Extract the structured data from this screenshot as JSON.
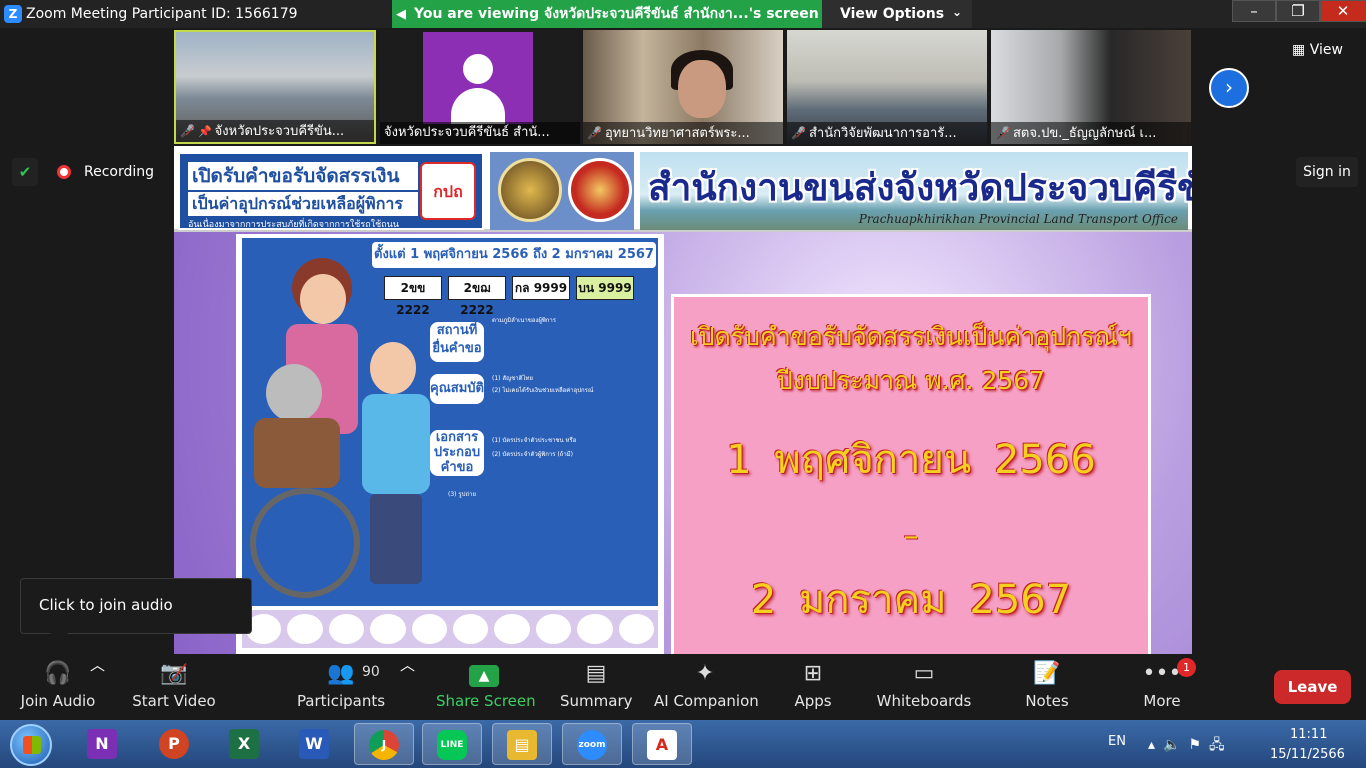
{
  "window": {
    "app_icon": "Z",
    "title": "Zoom Meeting Participant ID: 1566179",
    "banner": "You  are viewing จังหวัดประจวบคีรีขันธ์ สำนักงา...'s screen",
    "view_options": "View Options",
    "minimize": "–",
    "restore": "❐",
    "close": "✕"
  },
  "gallery": {
    "view_label": "View",
    "participants": [
      {
        "name": "จังหวัดประจวบคีรีขัน...",
        "muted": true,
        "pinned": true
      },
      {
        "name": "จังหวัดประจวบคีรีขันธ์ สำนั...",
        "muted": false,
        "pinned": false
      },
      {
        "name": "อุทยานวิทยาศาสตร์พระ...",
        "muted": true,
        "pinned": false
      },
      {
        "name": "สำนักวิจัยพัฒนาการอารั...",
        "muted": true,
        "pinned": false
      },
      {
        "name": "สตจ.ปข._ธัญญลักษณ์ เ...",
        "muted": true,
        "pinned": false
      }
    ],
    "next_icon": "›"
  },
  "status": {
    "recording_label": "Recording",
    "sign_in_label": "Sign in",
    "shield_icon": "✔"
  },
  "shared_screen": {
    "header_left_line1": "เปิดรับคำขอรับจัดสรรเงิน",
    "header_left_line2": "เป็นค่าอุปกรณ์ช่วยเหลือผู้พิการ",
    "header_left_line3": "อันเนื่องมาจากการประสบภัยที่เกิดจากการใช้รถใช้ถนน",
    "header_left_logo": "กปถ",
    "header_right_thai": "สำนักงานขนส่งจังหวัดประจวบคีรีขันธ์",
    "header_right_en": "Prachuapkhirikhan Provincial Land Transport Office",
    "poster_date": "ตั้งแต่ 1 พฤศจิกายน 2566 ถึง 2 มกราคม 2567",
    "plates": [
      "2ขข 2222",
      "2ขฌ 2222",
      "กล 9999",
      "บน 9999"
    ],
    "poster_labels": [
      "สถานที่ยื่นคำขอ",
      "คุณสมบัติ",
      "เอกสารประกอบคำขอ"
    ],
    "poster_notes": [
      "ตามภูมิลำเนาของผู้พิการ",
      "(1) สัญชาติไทย",
      "(2) ไม่เคยได้รับเงินช่วยเหลือค่าอุปกรณ์",
      "(1) บัตรประจำตัวประชาชน หรือ",
      "(2) บัตรประจำตัวผู้พิการ (ถ้ามี)",
      "(3) รูปถ่าย"
    ],
    "panel_line1": "เปิดรับคำขอรับจัดสรรเงินเป็นค่าอุปกรณ์ฯ",
    "panel_line2": "ปีงบประมาณ พ.ศ. 2567",
    "panel_date_start": "1  พฤศจิกายน  2566",
    "panel_dash": "–",
    "panel_date_end": "2  มกราคม  2567"
  },
  "tooltip": {
    "text": "Click to join audio"
  },
  "toolbar": {
    "join_audio": "Join Audio",
    "start_video": "Start Video",
    "participants": "Participants",
    "participant_count": "90",
    "share_screen": "Share Screen",
    "summary": "Summary",
    "ai_companion": "AI Companion",
    "apps": "Apps",
    "whiteboards": "Whiteboards",
    "notes": "Notes",
    "more": "More",
    "more_badge": "1",
    "leave": "Leave"
  },
  "taskbar": {
    "apps": [
      {
        "name": "OneNote",
        "glyph": "N",
        "color": "#7b2fb5"
      },
      {
        "name": "PowerPoint",
        "glyph": "P",
        "color": "#d04423"
      },
      {
        "name": "Excel",
        "glyph": "X",
        "color": "#1d7044"
      },
      {
        "name": "Word",
        "glyph": "W",
        "color": "#2a5ab8"
      },
      {
        "name": "Chrome",
        "glyph": "J",
        "color": "#2f9e44"
      },
      {
        "name": "LINE",
        "glyph": "LINE",
        "color": "#06c755"
      },
      {
        "name": "File Explorer",
        "glyph": "▤",
        "color": "#e8b830"
      },
      {
        "name": "Zoom",
        "glyph": "zoom",
        "color": "#2d8cff"
      },
      {
        "name": "Acrobat",
        "glyph": "A",
        "color": "#d42a20"
      }
    ],
    "language": "EN",
    "time": "11:11",
    "date": "15/11/2566"
  },
  "colors": {
    "zoom_green": "#23a247",
    "leave_red": "#cc2a2a",
    "zoom_blue": "#2d8cff"
  }
}
